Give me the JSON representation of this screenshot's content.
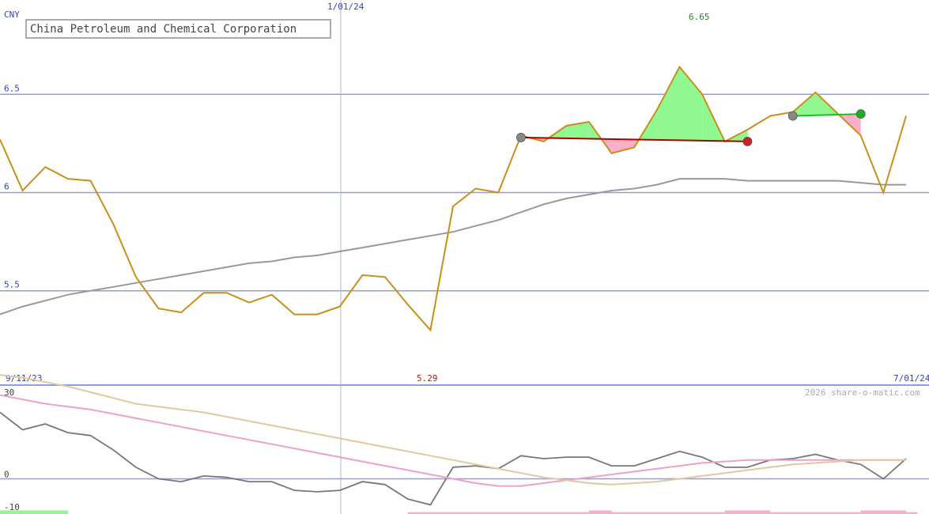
{
  "chart_data": [
    {
      "type": "line",
      "title": "China Petroleum and Chemical Corporation",
      "currency": "CNY",
      "date_start": "9/11/23",
      "date_mid": "1/01/24",
      "date_end": "7/01/24",
      "ylim": [
        5.02,
        6.98
      ],
      "yticks": [
        {
          "value": 6.5,
          "label": "6.5"
        },
        {
          "value": 6.0,
          "label": "6"
        },
        {
          "value": 5.5,
          "label": "5.5"
        }
      ],
      "max_label": "6.65",
      "min_label": "5.29",
      "watermark": "2026 share-o-matic.com",
      "price": [
        6.27,
        6.01,
        6.13,
        6.07,
        6.06,
        5.84,
        5.57,
        5.41,
        5.39,
        5.49,
        5.49,
        5.44,
        5.48,
        5.38,
        5.38,
        5.42,
        5.58,
        5.57,
        5.43,
        5.3,
        5.93,
        6.02,
        6.0,
        6.29,
        6.26,
        6.34,
        6.36,
        6.2,
        6.23,
        6.42,
        6.64,
        6.5,
        6.26,
        6.32,
        6.39,
        6.41,
        6.51,
        6.4,
        6.29,
        6.0,
        6.39
      ],
      "moving_average": [
        5.38,
        5.42,
        5.45,
        5.48,
        5.5,
        5.52,
        5.54,
        5.56,
        5.58,
        5.6,
        5.62,
        5.64,
        5.65,
        5.67,
        5.68,
        5.7,
        5.72,
        5.74,
        5.76,
        5.78,
        5.8,
        5.83,
        5.86,
        5.9,
        5.94,
        5.97,
        5.99,
        6.01,
        6.02,
        6.04,
        6.07,
        6.07,
        6.07,
        6.06,
        6.06,
        6.06,
        6.06,
        6.06,
        6.05,
        6.04,
        6.04
      ],
      "support_red": {
        "from_index": 23,
        "to_index": 33,
        "from_value": 6.28,
        "to_value": 6.26
      },
      "support_green": {
        "from_index": 35,
        "to_index": 38,
        "from_value": 6.39,
        "to_value": 6.4
      },
      "markers": [
        {
          "index": 23,
          "color": "#888888"
        },
        {
          "index": 33,
          "color": "#cc2222"
        },
        {
          "index": 35,
          "color": "#888888"
        },
        {
          "index": 38,
          "color": "#22aa22"
        }
      ],
      "colors": {
        "price": "#c8901a",
        "moving_average": "#999999",
        "grid": "#8c9ee6",
        "fill_up": "#90f890",
        "fill_down": "#f8b0c8",
        "support_red": "#aa0000",
        "support_green": "#22bb22",
        "max_label": "#228822",
        "min_label": "#aa2222",
        "axis_text": "#3344bb"
      }
    },
    {
      "type": "line",
      "ylim": [
        -10,
        30
      ],
      "yticks": [
        {
          "value": 30,
          "label": "30"
        },
        {
          "value": 0,
          "label": "0"
        },
        {
          "value": -10,
          "label": "-10"
        }
      ],
      "series": [
        {
          "values": [
            23,
            17,
            19,
            16,
            15,
            10,
            4,
            0,
            -1,
            1,
            0.5,
            -1,
            -1,
            -4,
            -4.5,
            -4,
            -1,
            -2,
            -7,
            -9,
            4,
            4.5,
            3.5,
            8,
            7,
            7.5,
            7.5,
            4.5,
            4.5,
            7,
            9.5,
            7.5,
            4,
            4,
            6.5,
            7,
            8.5,
            6.5,
            5,
            0,
            7
          ],
          "color": "#777777"
        },
        {
          "values": [
            29,
            27.5,
            26,
            25,
            24,
            22.5,
            21,
            19.5,
            18,
            16.5,
            15,
            13.5,
            12,
            10.5,
            9,
            7.5,
            6,
            4.5,
            3,
            1.5,
            0,
            -1.5,
            -2.5,
            -2.5,
            -1.5,
            -0.5,
            0.5,
            1.5,
            2.5,
            3.5,
            4.5,
            5.5,
            6,
            6.5,
            6.5,
            6.5,
            6.5,
            6.5,
            6.5,
            6.5,
            6.5
          ],
          "color": "#f0a0c8"
        },
        {
          "values": [
            36,
            35,
            33.5,
            32,
            30,
            28,
            26,
            25,
            24,
            23,
            21.5,
            20,
            18.5,
            17,
            15.5,
            14,
            12.5,
            11,
            9.5,
            8,
            6.5,
            5,
            3.5,
            2,
            0.5,
            -0.5,
            -1.5,
            -2,
            -1.5,
            -1,
            0,
            1,
            2,
            3,
            4,
            5,
            5.5,
            6,
            6.5,
            6.5,
            6.5
          ],
          "color": "#e0c8a0"
        }
      ],
      "bars": [
        {
          "from_index": 0,
          "to_index": 3,
          "color": "#90f890",
          "value": 1.5
        },
        {
          "from_index": 18,
          "to_index": 21,
          "color": "#f8b0c8",
          "value": 0.8
        },
        {
          "from_index": 21,
          "to_index": 26,
          "color": "#f8b0c8",
          "value": 0.8
        },
        {
          "from_index": 26,
          "to_index": 27,
          "color": "#f8b0c8",
          "value": 1.5
        },
        {
          "from_index": 27,
          "to_index": 32,
          "color": "#f8b0c8",
          "value": 0.8
        },
        {
          "from_index": 32,
          "to_index": 34,
          "color": "#f8b0c8",
          "value": 1.5
        },
        {
          "from_index": 34,
          "to_index": 38,
          "color": "#f8b0c8",
          "value": 0.8
        },
        {
          "from_index": 38,
          "to_index": 40,
          "color": "#f8b0c8",
          "value": 1.5
        },
        {
          "from_index": 40,
          "to_index": 40.5,
          "color": "#f8b0c8",
          "value": 0.8
        }
      ]
    }
  ]
}
